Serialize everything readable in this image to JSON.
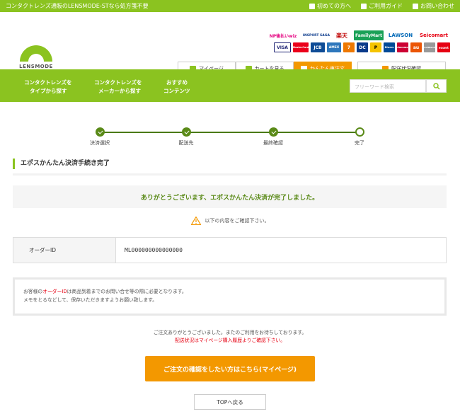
{
  "topbar": {
    "tagline": "コンタクトレンズ通販のLENSMODE-STなら処方箋不要",
    "links": [
      {
        "label": "初めての方へ",
        "icon": "book-icon"
      },
      {
        "label": "ご利用ガイド",
        "icon": "check-icon"
      },
      {
        "label": "お問い合わせ",
        "icon": "mail-icon"
      }
    ]
  },
  "logo": {
    "text": "LENSMODE"
  },
  "payment_logos": [
    [
      "NP後払いwiz",
      "TRANSPORT SAGAWA",
      "楽天",
      "FamilyMart",
      "LAWSON",
      "Seicomart"
    ],
    [
      "VISA",
      "MasterCard",
      "JCB",
      "AMEX",
      "7",
      "DC",
      "P",
      "Diners",
      "docomo",
      "au",
      "SoftBank",
      "ecomt"
    ]
  ],
  "header_buttons": [
    {
      "label": "マイページ",
      "icon": "person-icon"
    },
    {
      "label": "カートを見る",
      "icon": "cart-icon"
    },
    {
      "label": "かんたん再注文",
      "icon": "reorder-icon"
    },
    {
      "label": "配送状況確認",
      "icon": "truck-icon"
    }
  ],
  "nav": [
    {
      "line1": "コンタクトレンズを",
      "line2": "タイプから探す"
    },
    {
      "line1": "コンタクトレンズを",
      "line2": "メーカーから探す"
    },
    {
      "line1": "おすすめ",
      "line2": "コンテンツ"
    }
  ],
  "search": {
    "placeholder": "フリーワード検索"
  },
  "steps": [
    "決済選択",
    "配送先",
    "最終確認",
    "完了"
  ],
  "section_title": "エポスかんたん決済手続き完了",
  "thanks_message": "ありがとうございます、エポスかんたん決済が完了しました。",
  "confirm_note": "以下の内容をご確認下さい。",
  "order": {
    "key": "オーダーID",
    "value": "ML000000000000000"
  },
  "note": {
    "part1": "お客様の",
    "highlight": "オーダーID",
    "part2": "は商品到着までのお問い合せ等の際に必要となります。",
    "line2": "メモをとるなどして、保存いただきますようお願い致します。"
  },
  "closing": {
    "line1": "ご注文ありがとうございました。またのご利用をお待ちしております。",
    "line2": "配送状況はマイページ購入履歴よりご確認下さい。"
  },
  "mypage_button": "ご注文の確認をしたい方はこちら(マイページ)",
  "top_button": "TOPへ戻る",
  "colors": {
    "brand_green": "#8bc320",
    "accent_orange": "#f39800",
    "dark_green": "#5a8a18",
    "alert_red": "#e60012"
  }
}
